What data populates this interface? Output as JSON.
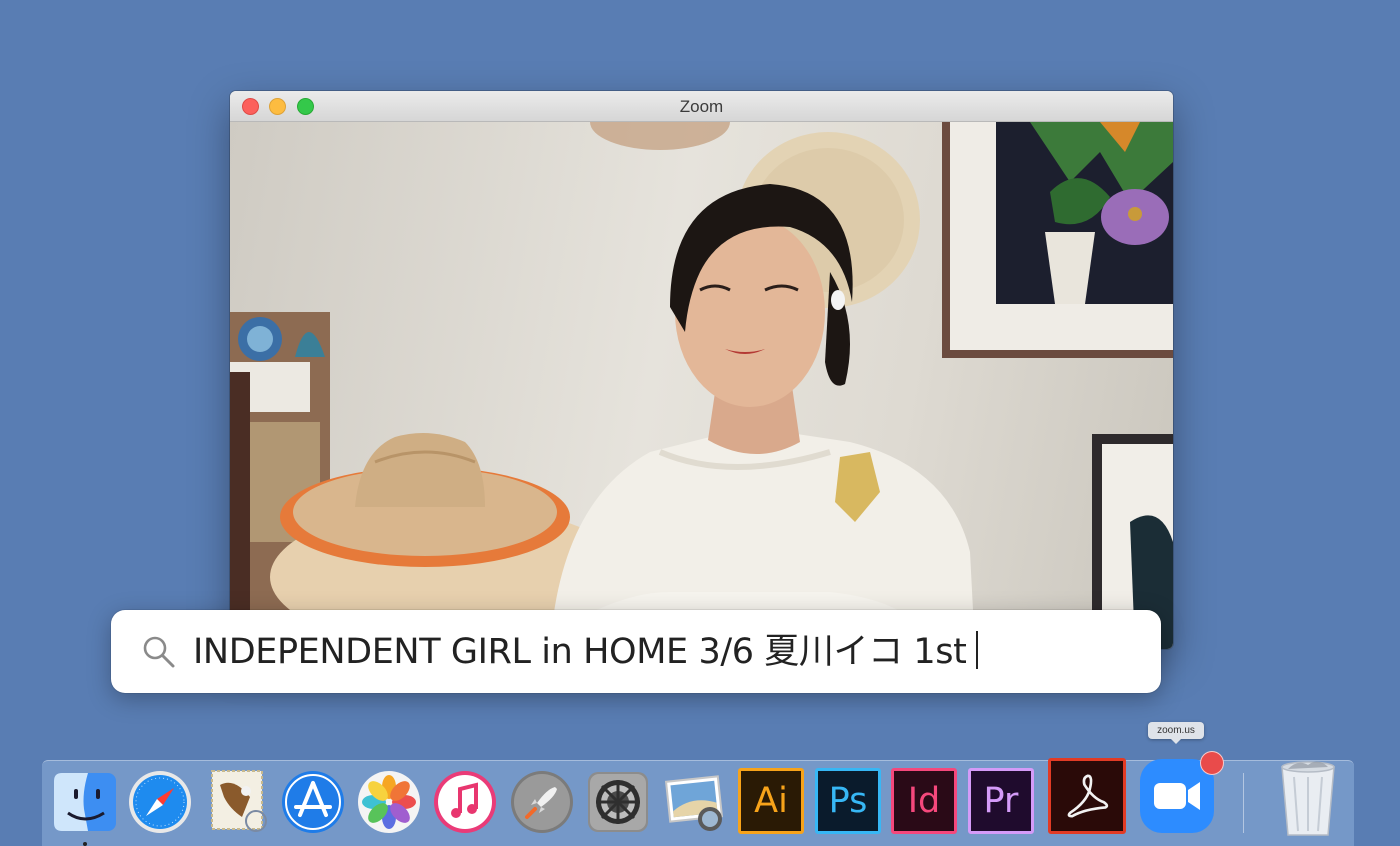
{
  "window": {
    "title": "Zoom"
  },
  "search": {
    "query": "INDEPENDENT GIRL in HOME 3/6 夏川イコ 1st"
  },
  "dock": {
    "tooltip": "zoom.us",
    "apps": [
      {
        "name": "finder",
        "icon": "finder-icon"
      },
      {
        "name": "safari",
        "icon": "safari-icon"
      },
      {
        "name": "mail",
        "icon": "mail-icon"
      },
      {
        "name": "app-store",
        "icon": "app-store-icon"
      },
      {
        "name": "photos",
        "icon": "photos-icon"
      },
      {
        "name": "itunes",
        "icon": "music-icon"
      },
      {
        "name": "launchpad",
        "icon": "rocket-icon"
      },
      {
        "name": "system-preferences",
        "icon": "gear-icon"
      },
      {
        "name": "preview",
        "icon": "preview-icon"
      },
      {
        "name": "illustrator",
        "label": "Ai",
        "fg": "#f7a31a",
        "bg": "#2a1a05"
      },
      {
        "name": "photoshop",
        "label": "Ps",
        "fg": "#37b7f5",
        "bg": "#0a1b2c"
      },
      {
        "name": "indesign",
        "label": "Id",
        "fg": "#f5487c",
        "bg": "#2a0a17"
      },
      {
        "name": "premiere",
        "label": "Pr",
        "fg": "#d49bf8",
        "bg": "#1f0b2d"
      },
      {
        "name": "acrobat",
        "icon": "acrobat-icon"
      },
      {
        "name": "zoom",
        "icon": "camera-icon"
      },
      {
        "name": "trash",
        "icon": "trash-icon"
      }
    ]
  },
  "colors": {
    "desktop": "#597db3",
    "zoom_blue": "#2d8cff",
    "badge": "#e94b4b"
  }
}
